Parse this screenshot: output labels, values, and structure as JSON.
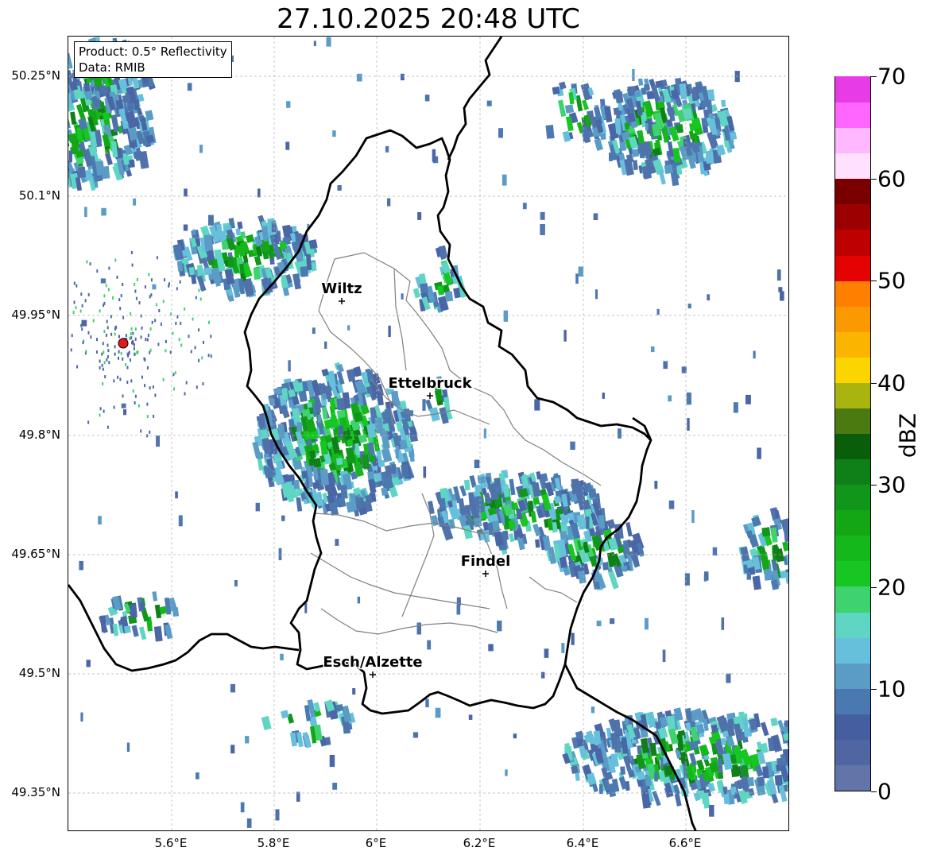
{
  "title": "27.10.2025 20:48 UTC",
  "info_box": {
    "line1": "Product: 0.5° Reflectivity",
    "line2": "Data: RMIB"
  },
  "lat_labels": [
    "50.25°N",
    "50.1°N",
    "49.95°N",
    "49.8°N",
    "49.65°N",
    "49.5°N",
    "49.35°N"
  ],
  "lon_labels": [
    "5.6°E",
    "5.8°E",
    "6°E",
    "6.2°E",
    "6.4°E",
    "6.6°E"
  ],
  "cities": [
    {
      "name": "Wiltz"
    },
    {
      "name": "Ettelbruck"
    },
    {
      "name": "Findel"
    },
    {
      "name": "Esch/Alzette"
    }
  ],
  "colorbar": {
    "label": "dBZ",
    "ticks": [
      "0",
      "10",
      "20",
      "30",
      "40",
      "50",
      "60",
      "70"
    ],
    "colors": [
      "#6175a8",
      "#4f66a3",
      "#455ea0",
      "#4a78b0",
      "#5a9cc6",
      "#66c0dc",
      "#5fd6c4",
      "#3fd36f",
      "#16c621",
      "#15b81a",
      "#13a716",
      "#10961a",
      "#0e8017",
      "#0a5e0a",
      "#4b7a10",
      "#aab40e",
      "#fcd500",
      "#fbb500",
      "#fa9a00",
      "#ff7f00",
      "#e40202",
      "#be0000",
      "#9d0000",
      "#7a0000",
      "#ffe1ff",
      "#ffb7ff",
      "#ff66ff",
      "#e83be8"
    ]
  },
  "colors": {
    "border_country": "#000000",
    "border_canton": "#808080",
    "grid": "#b0b0b0",
    "radar_site": "#e31a1c"
  }
}
